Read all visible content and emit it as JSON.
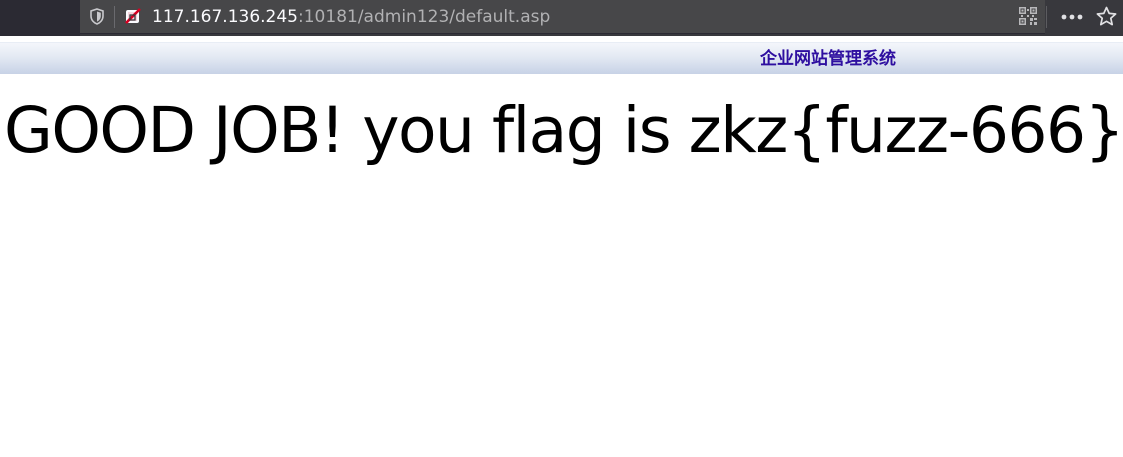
{
  "browser": {
    "url_host": "117.167.136.245",
    "url_rest": ":10181/admin123/default.asp",
    "icons": {
      "tracking": "shield-icon",
      "security": "insecure-connection-icon",
      "qr": "qr-code-icon",
      "menu": "more-horizontal-icon",
      "bookmark": "star-icon"
    },
    "colors": {
      "chrome": "#38383d",
      "url_host": "#fbfbfe",
      "url_rest": "#b1b1b3"
    }
  },
  "header": {
    "title": "企业网站管理系统",
    "title_color": "#2e0fa0"
  },
  "main": {
    "message": "GOOD JOB! you flag is zkz{fuzz-666}"
  }
}
